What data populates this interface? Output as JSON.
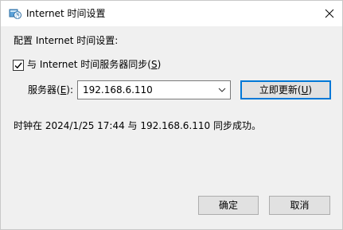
{
  "window": {
    "title": "Internet 时间设置",
    "close_glyph": "✕"
  },
  "config": {
    "heading": "配置 Internet 时间设置:"
  },
  "sync_checkbox": {
    "checked": true,
    "label_prefix": "与 Internet 时间服务器同步(",
    "accel": "S",
    "label_suffix": ")"
  },
  "server": {
    "label_prefix": "服务器(",
    "accel": "E",
    "label_suffix": "):",
    "value": "192.168.6.110"
  },
  "update_button": {
    "label_prefix": "立即更新(",
    "accel": "U",
    "label_suffix": ")"
  },
  "status": {
    "message": "时钟在 2024/1/25 17:44 与 192.168.6.110 同步成功。"
  },
  "footer": {
    "ok_label": "确定",
    "cancel_label": "取消"
  },
  "colors": {
    "accent": "#0078d7",
    "dialog_bg": "#f0f0f0"
  },
  "icons": {
    "title": "internet-time-globe-icon",
    "close": "close-icon",
    "checkbox": "checkmark-icon",
    "dropdown": "chevron-down-icon"
  }
}
